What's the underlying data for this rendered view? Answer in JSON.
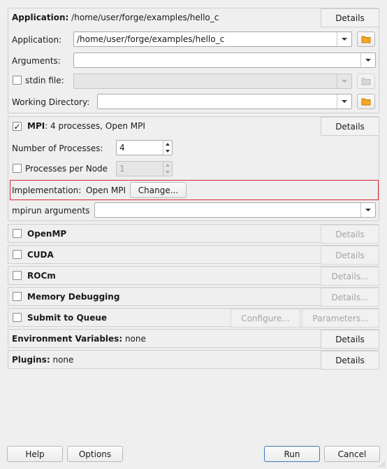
{
  "application": {
    "header_label": "Application:",
    "header_value": "/home/user/forge/examples/hello_c",
    "details_label": "Details",
    "app_label": "Application:",
    "app_value": "/home/user/forge/examples/hello_c",
    "args_label": "Arguments:",
    "args_value": "",
    "stdin_label": "stdin file:",
    "stdin_value": "",
    "workdir_label": "Working Directory:",
    "workdir_value": ""
  },
  "mpi": {
    "checked": true,
    "header_label": "MPI",
    "header_value": ": 4 processes, Open MPI",
    "details_label": "Details",
    "nprocs_label": "Number of Processes:",
    "nprocs_value": "4",
    "ppn_label": "Processes per Node",
    "ppn_value": "1",
    "impl_label": "Implementation:",
    "impl_value": "Open MPI",
    "change_label": "Change...",
    "mpirun_label": "mpirun arguments",
    "mpirun_value": ""
  },
  "openmp": {
    "label": "OpenMP",
    "details_label": "Details"
  },
  "cuda": {
    "label": "CUDA",
    "details_label": "Details"
  },
  "rocm": {
    "label": "ROCm",
    "details_label": "Details..."
  },
  "memdebug": {
    "label": "Memory Debugging",
    "details_label": "Details..."
  },
  "queue": {
    "label": "Submit to Queue",
    "configure_label": "Configure...",
    "parameters_label": "Parameters..."
  },
  "env": {
    "label": "Environment Variables:",
    "value": "none",
    "details_label": "Details"
  },
  "plugins": {
    "label": "Plugins:",
    "value": "none",
    "details_label": "Details"
  },
  "footer": {
    "help": "Help",
    "options": "Options",
    "run": "Run",
    "cancel": "Cancel"
  },
  "icons": {
    "folder": "folder-icon",
    "checkmark": "check-icon",
    "dropdown": "chevron-down-icon",
    "resize": "resize-grip-icon"
  },
  "colors": {
    "folder": "#f5a623",
    "highlight_border": "#d9262e",
    "run_border": "#3d79c2"
  }
}
